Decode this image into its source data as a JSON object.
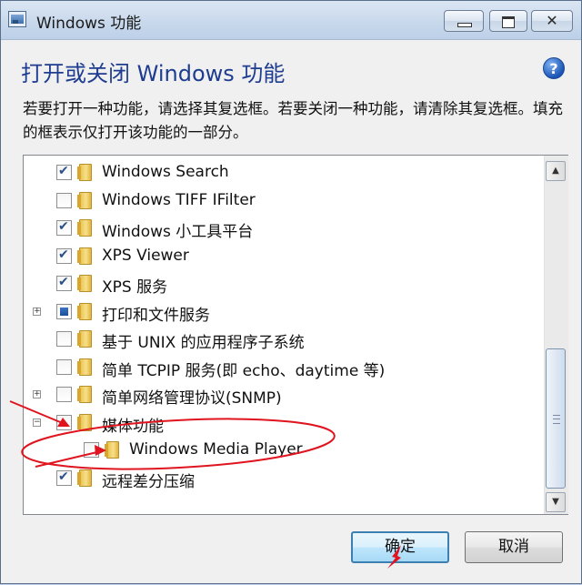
{
  "window": {
    "title": "Windows 功能",
    "minimize_icon": "minimize-icon",
    "maximize_icon": "maximize-icon",
    "close_icon": "close-icon",
    "close_glyph": "✕"
  },
  "header": {
    "heading": "打开或关闭 Windows 功能",
    "help_glyph": "?"
  },
  "description": "若要打开一种功能，请选择其复选框。若要关闭一种功能，请清除其复选框。填充的框表示仅打开该功能的一部分。",
  "features": [
    {
      "label": "Windows Search",
      "state": "checked",
      "expander": "",
      "indent": 0
    },
    {
      "label": "Windows TIFF IFilter",
      "state": "unchecked",
      "expander": "",
      "indent": 0
    },
    {
      "label": "Windows 小工具平台",
      "state": "checked",
      "expander": "",
      "indent": 0
    },
    {
      "label": "XPS Viewer",
      "state": "checked",
      "expander": "",
      "indent": 0
    },
    {
      "label": "XPS 服务",
      "state": "checked",
      "expander": "",
      "indent": 0
    },
    {
      "label": "打印和文件服务",
      "state": "partial",
      "expander": "+",
      "indent": 0
    },
    {
      "label": "基于 UNIX 的应用程序子系统",
      "state": "unchecked",
      "expander": "",
      "indent": 0
    },
    {
      "label": "简单 TCPIP 服务(即 echo、daytime 等)",
      "state": "unchecked",
      "expander": "",
      "indent": 0
    },
    {
      "label": "简单网络管理协议(SNMP)",
      "state": "unchecked",
      "expander": "+",
      "indent": 0
    },
    {
      "label": "媒体功能",
      "state": "unchecked",
      "expander": "−",
      "indent": 0
    },
    {
      "label": "Windows Media Player",
      "state": "unchecked",
      "expander": "",
      "indent": 1
    },
    {
      "label": "远程差分压缩",
      "state": "checked",
      "expander": "",
      "indent": 0
    }
  ],
  "scrollbar": {
    "up_glyph": "▲",
    "down_glyph": "▼"
  },
  "buttons": {
    "ok": "确定",
    "cancel": "取消"
  },
  "colors": {
    "heading": "#1e3d90",
    "annotation": "#e0141e",
    "ok_border": "#3c7fb1"
  }
}
